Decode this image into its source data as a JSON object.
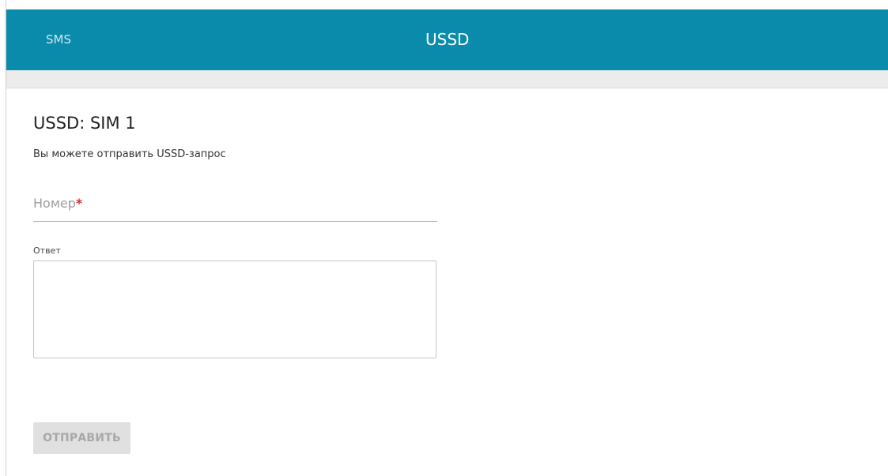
{
  "tabs": [
    {
      "label": "SMS",
      "active": false
    },
    {
      "label": "USSD",
      "active": true
    }
  ],
  "section": {
    "title": "USSD: SIM 1",
    "description": "Вы можете отправить USSD-запрос"
  },
  "form": {
    "number_label": "Номер",
    "number_required_mark": "*",
    "number_value": "",
    "answer_label": "Ответ",
    "answer_value": "",
    "send_label": "ОТПРАВИТЬ",
    "send_enabled": false
  },
  "colors": {
    "tabbar_bg": "#0b8bab",
    "required_mark": "#d32f2f",
    "button_disabled_bg": "#e0e0e0"
  }
}
